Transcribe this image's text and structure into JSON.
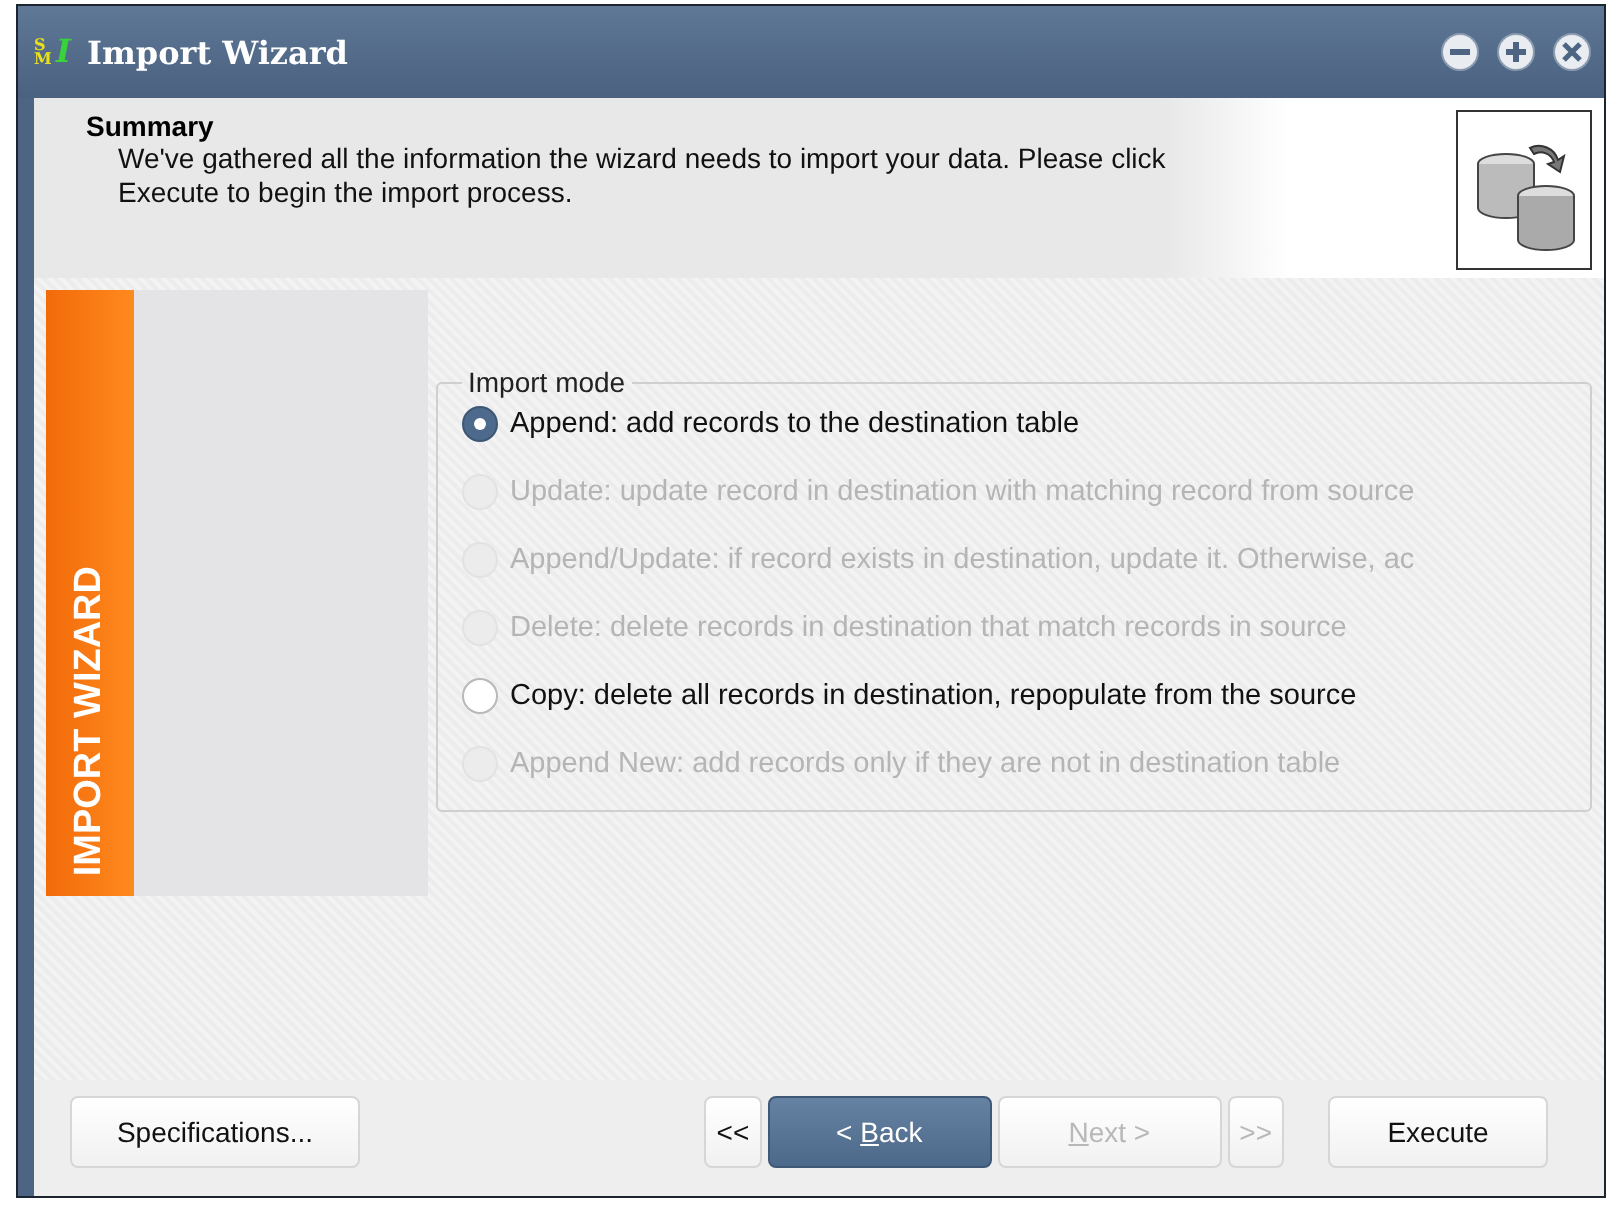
{
  "window": {
    "title": "Import Wizard",
    "logo": {
      "letters": "SM",
      "mark": "I"
    }
  },
  "header": {
    "title": "Summary",
    "description": "We've gathered all the information the wizard needs to import your data. Please click Execute to begin the import process."
  },
  "side_banner": {
    "label": "IMPORT WIZARD"
  },
  "import_mode": {
    "legend": "Import mode",
    "options": [
      {
        "label": "Append: add records to the destination table",
        "selected": true,
        "disabled": false
      },
      {
        "label": "Update: update record in destination with matching record from source",
        "selected": false,
        "disabled": true
      },
      {
        "label": "Append/Update: if record exists in destination, update it. Otherwise, ac",
        "selected": false,
        "disabled": true
      },
      {
        "label": "Delete: delete records in destination that match records in source",
        "selected": false,
        "disabled": true
      },
      {
        "label": "Copy: delete all records in destination, repopulate from the source",
        "selected": false,
        "disabled": false
      },
      {
        "label": "Append New: add records only if they are not in destination table",
        "selected": false,
        "disabled": true
      }
    ]
  },
  "buttons": {
    "specifications": {
      "label": "Specifications..."
    },
    "first": {
      "label": "<<",
      "disabled": false
    },
    "back": {
      "before": "< ",
      "key": "B",
      "after": "ack",
      "primary": true,
      "disabled": false
    },
    "next": {
      "key": "N",
      "after": "ext >",
      "primary": false,
      "disabled": true
    },
    "last": {
      "label": ">>",
      "disabled": true
    },
    "execute": {
      "label": "Execute"
    }
  }
}
